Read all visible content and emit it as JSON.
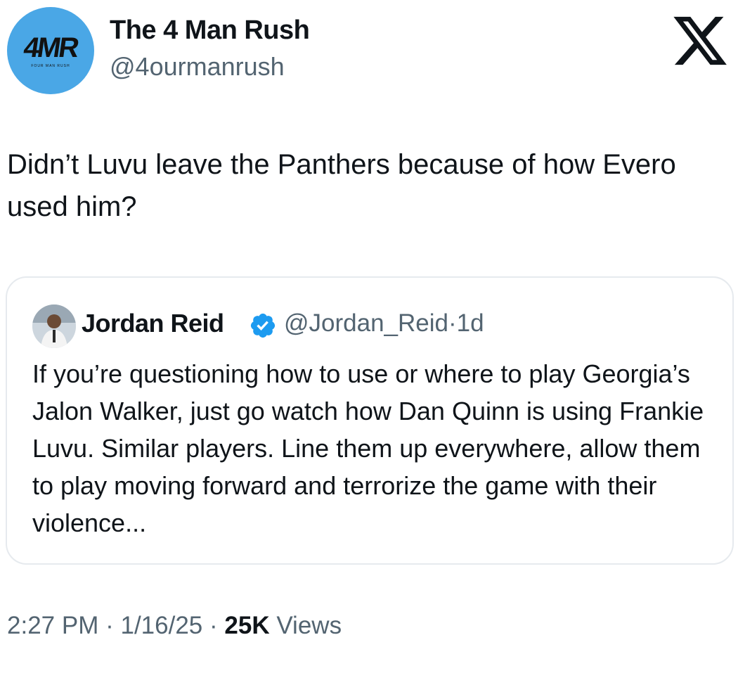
{
  "author": {
    "avatar_text": "4MR",
    "avatar_subtext": "FOUR MAN RUSH",
    "avatar_color": "#4aa7e6",
    "display_name": "The 4 Man Rush",
    "handle": "@4ourmanrush"
  },
  "platform_icon": "x-logo-icon",
  "tweet_text": "Didn’t Luvu leave the Panthers because of how Evero used him?",
  "quoted_tweet": {
    "avatar_icon": "profile-photo",
    "display_name": "Jordan Reid",
    "verified_icon": "verified-badge-icon",
    "verified_color": "#1d9bf0",
    "handle": "@Jordan_Reid",
    "separator": "·",
    "time_ago": "1d",
    "text": "If you’re questioning how to use or where to play Georgia’s Jalon Walker, just go watch how Dan Quinn is using Frankie Luvu. Similar players. Line them up everywhere, allow them to play moving forward and terrorize the game with their violence..."
  },
  "footer": {
    "time": "2:27 PM",
    "date": "1/16/25",
    "separator": "·",
    "views_count": "25K",
    "views_label": "Views"
  }
}
